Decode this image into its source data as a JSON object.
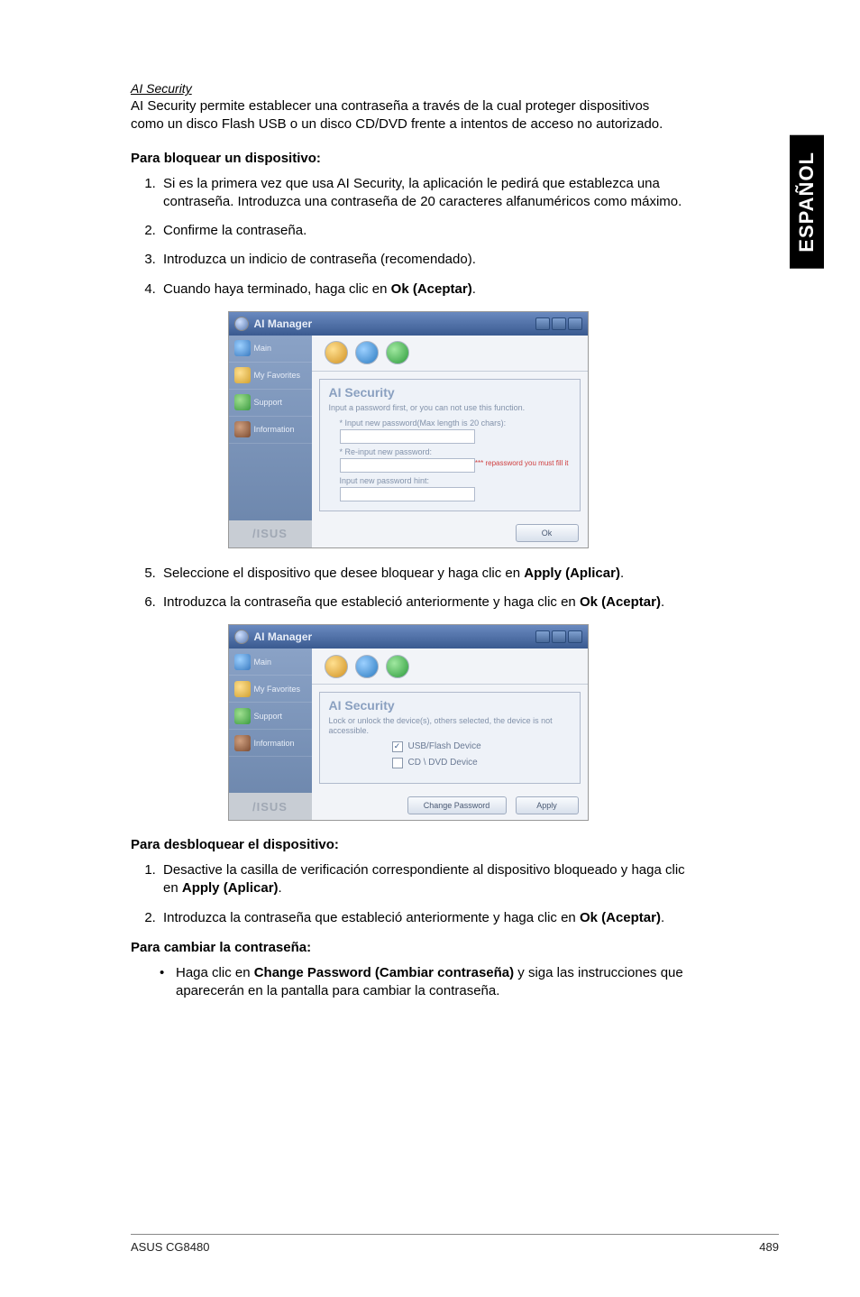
{
  "side_tab": "ESPAÑOL",
  "section": {
    "title": "AI Security",
    "intro": "AI Security permite establecer una contraseña a través de la cual proteger dispositivos como un disco Flash USB o un disco CD/DVD frente a intentos de acceso no autorizado."
  },
  "block_lock": {
    "heading": "Para bloquear un dispositivo:",
    "steps": [
      "Si es la primera vez que usa AI Security, la aplicación le pedirá que establezca una contraseña. Introduzca una contraseña de 20 caracteres alfanuméricos como máximo.",
      "Confirme la contraseña.",
      "Introduzca un indicio de contraseña (recomendado).",
      {
        "pre": "Cuando haya terminado, haga clic en ",
        "bold": "Ok (Aceptar)",
        "post": "."
      },
      {
        "pre": "Seleccione el dispositivo que desee bloquear y haga clic en ",
        "bold": "Apply (Aplicar)",
        "post": "."
      },
      {
        "pre": "Introduzca la contraseña que estableció anteriormente y haga clic en ",
        "bold": "Ok (Aceptar)",
        "post": "."
      }
    ]
  },
  "block_unlock": {
    "heading": "Para desbloquear el dispositivo:",
    "steps": [
      {
        "pre": "Desactive la casilla de verificación correspondiente al dispositivo bloqueado y haga clic en ",
        "bold": "Apply (Aplicar)",
        "post": "."
      },
      {
        "pre": "Introduzca la contraseña que estableció anteriormente y haga clic en ",
        "bold": "Ok (Aceptar)",
        "post": "."
      }
    ]
  },
  "block_change": {
    "heading": "Para cambiar la contraseña:",
    "bullet": {
      "pre": "Haga clic en ",
      "bold": "Change Password (Cambiar contraseña)",
      "post": " y siga las instrucciones que aparecerán en la pantalla para cambiar la contraseña."
    }
  },
  "screenshot1": {
    "title": "AI Manager",
    "side_items": [
      "Main",
      "My Favorites",
      "Support",
      "Information"
    ],
    "brand": "/ISUS",
    "panel_title": "AI Security",
    "panel_desc": "Input a password first, or you can not use this function.",
    "field1": "* Input new password(Max length is 20 chars):",
    "field2": "* Re-input new password:",
    "warn": "*** repassword you must fill it",
    "field3": "Input new password hint:",
    "ok": "Ok"
  },
  "screenshot2": {
    "title": "AI Manager",
    "side_items": [
      "Main",
      "My Favorites",
      "Support",
      "Information"
    ],
    "brand": "/ISUS",
    "panel_title": "AI Security",
    "panel_desc": "Lock or unlock the device(s), others selected, the device is not accessible.",
    "opt1": "USB/Flash Device",
    "opt2": "CD \\ DVD Device",
    "btn_change": "Change Password",
    "btn_apply": "Apply"
  },
  "footer": {
    "left": "ASUS CG8480",
    "right": "489"
  }
}
